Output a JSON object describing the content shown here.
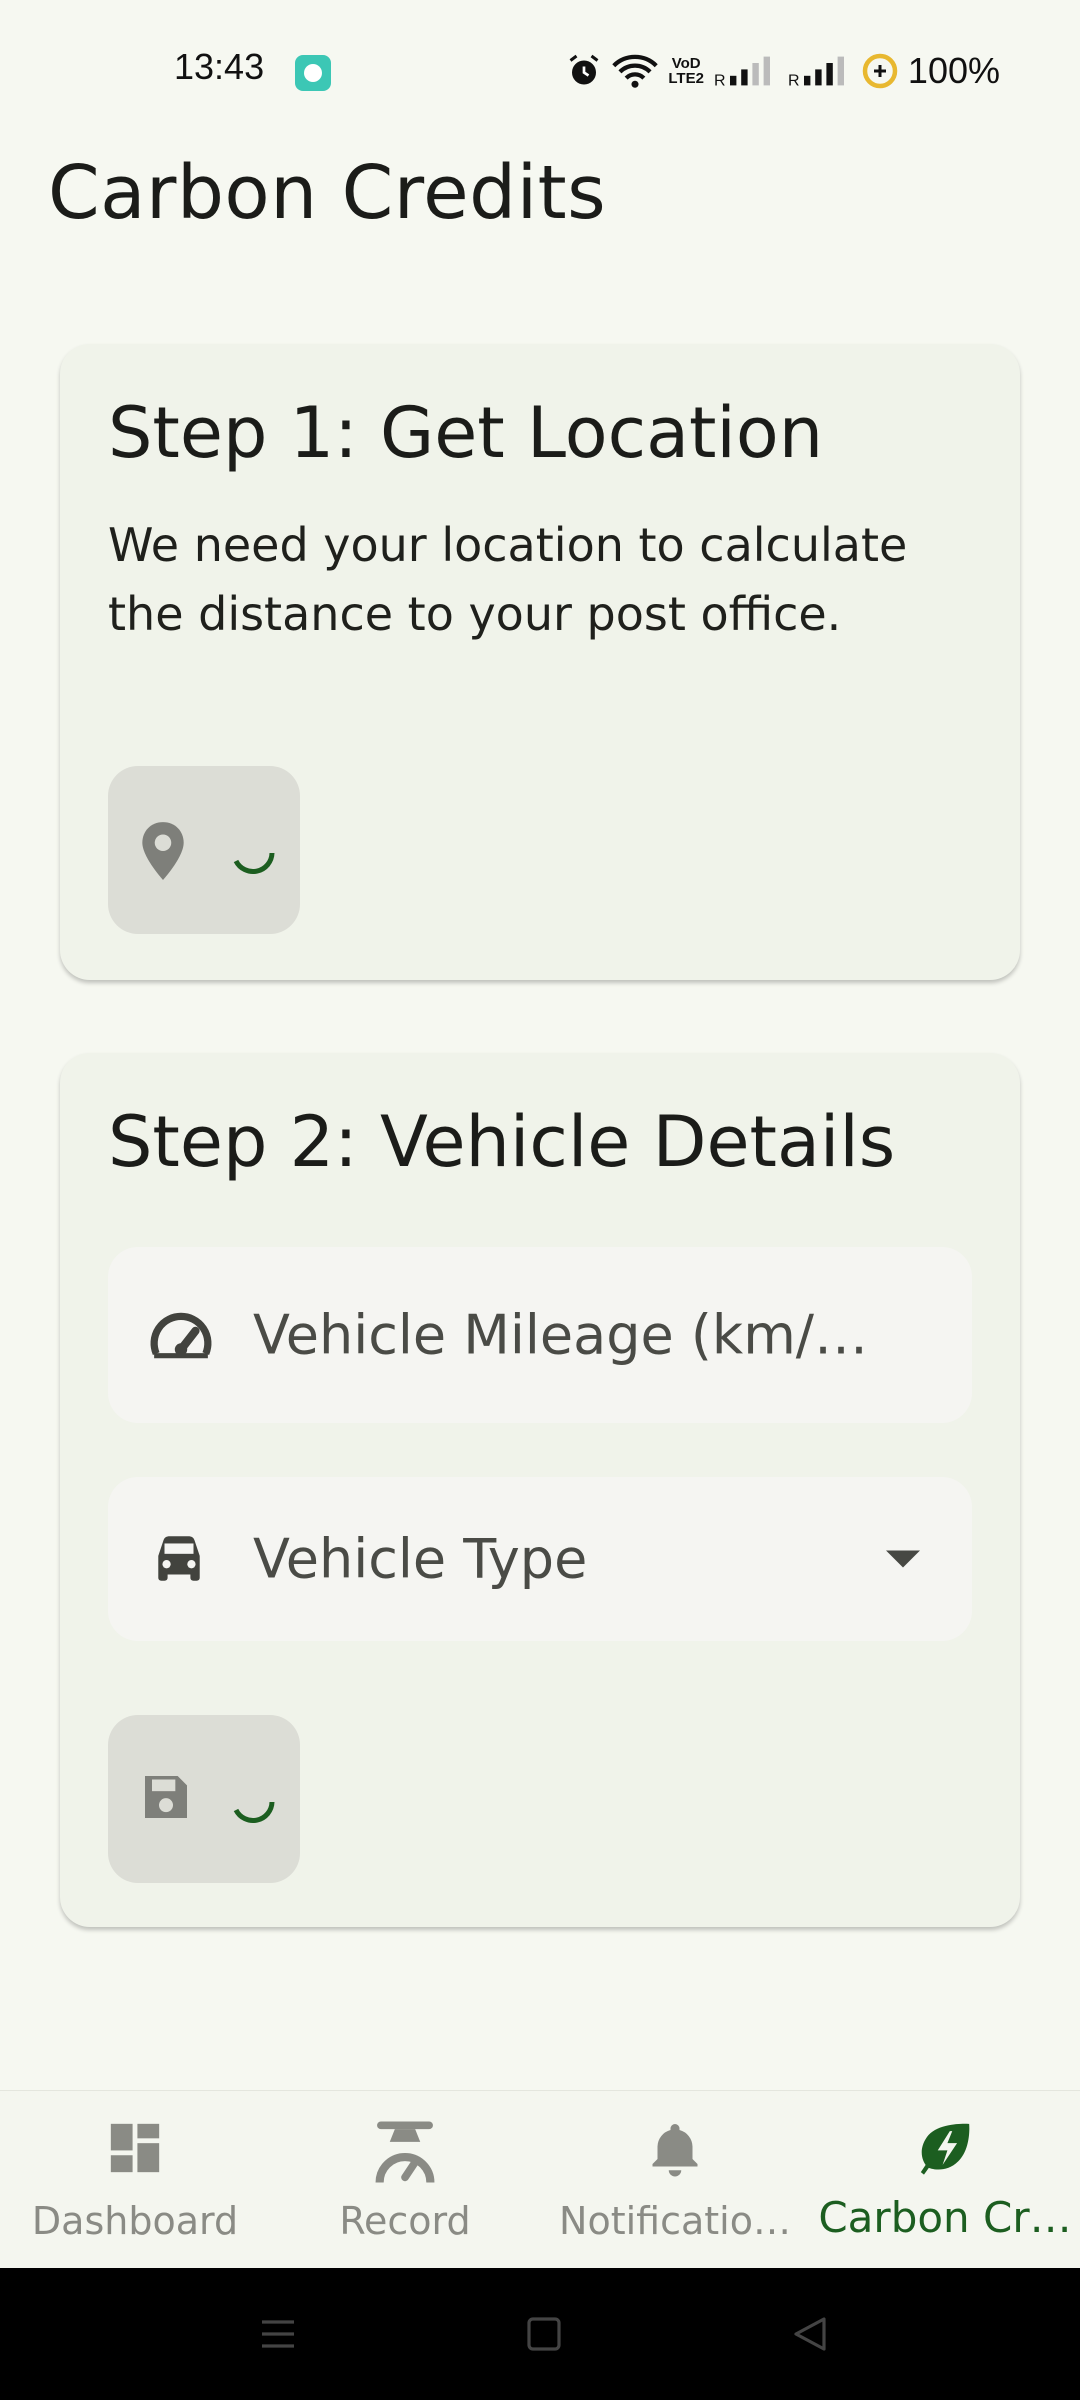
{
  "status_bar": {
    "time": "13:43",
    "icons": [
      "notification-badge-icon",
      "alarm-icon",
      "wifi-icon",
      "volte-icon",
      "signal-icon",
      "signal-icon",
      "battery-saver-icon"
    ],
    "vod_label": "VoD\nLTE2",
    "roaming_label": "R",
    "battery": "100%"
  },
  "page": {
    "title": "Carbon Credits"
  },
  "step1": {
    "title": "Step 1: Get Location",
    "description": "We need your location to calculate the distance to your post office.",
    "button_icon": "location-pin-icon",
    "loading": true
  },
  "step2": {
    "title": "Step 2: Vehicle Details",
    "mileage_field": {
      "icon": "speedometer-icon",
      "placeholder": "Vehicle Mileage (km/…"
    },
    "vehicle_type": {
      "icon": "car-icon",
      "label": "Vehicle Type"
    },
    "button_icon": "save-icon",
    "loading": true
  },
  "bottom_nav": {
    "items": [
      {
        "label": "Dashboard",
        "icon": "dashboard-icon",
        "active": false
      },
      {
        "label": "Record",
        "icon": "scale-icon",
        "active": false
      },
      {
        "label": "Notificatio…",
        "icon": "bell-icon",
        "active": false
      },
      {
        "label": "Carbon Cr…",
        "icon": "eco-bolt-icon",
        "active": true
      }
    ]
  },
  "colors": {
    "background": "#f6f8f1",
    "card": "#f0f3ea",
    "accent": "#1c5e20",
    "inactive": "#8a8b85"
  }
}
